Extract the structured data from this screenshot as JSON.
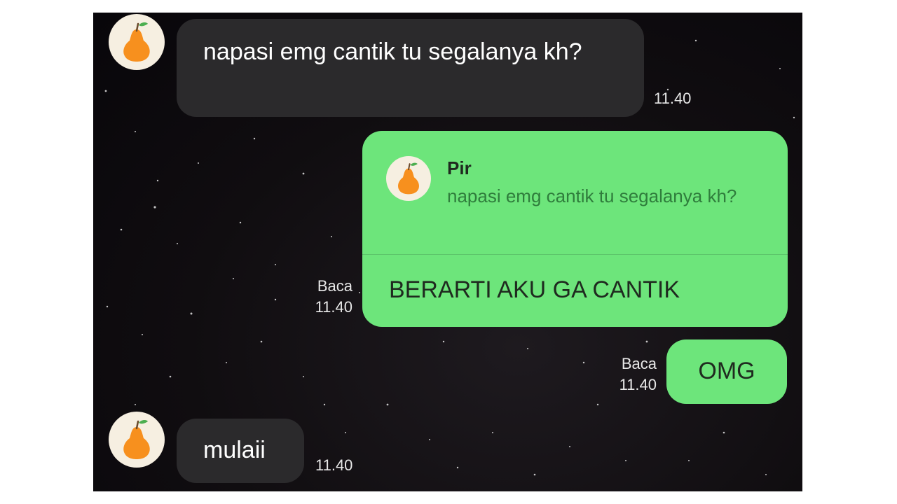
{
  "contact": {
    "name": "Pir",
    "avatar_icon": "pear-icon"
  },
  "colors": {
    "incoming_bubble": "#2b2a2c",
    "outgoing_bubble": "#6de57b",
    "background": "#100d10",
    "reply_text": "#2f7d3c"
  },
  "messages": [
    {
      "direction": "incoming",
      "text": "napasi emg cantik tu segalanya kh?",
      "time": "11.40"
    },
    {
      "direction": "outgoing",
      "reply_to": {
        "name": "Pir",
        "text": "napasi emg cantik tu segalanya kh?"
      },
      "text": "BERARTI AKU GA CANTIK",
      "read_label": "Baca",
      "time": "11.40"
    },
    {
      "direction": "outgoing",
      "text": "OMG",
      "read_label": "Baca",
      "time": "11.40"
    },
    {
      "direction": "incoming",
      "text": "mulaii",
      "time": "11.40"
    }
  ]
}
